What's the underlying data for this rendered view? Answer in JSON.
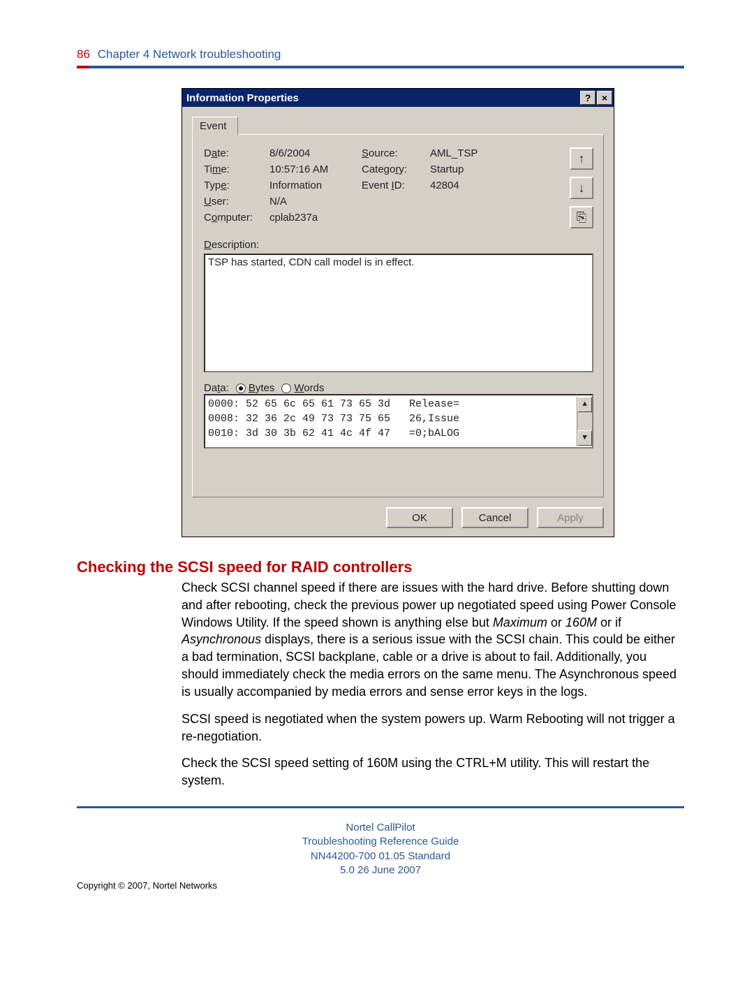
{
  "header": {
    "page_number": "86",
    "chapter": "Chapter 4  Network troubleshooting"
  },
  "dialog": {
    "title": "Information Properties",
    "help_btn": "?",
    "close_btn": "×",
    "tab_label": "Event",
    "fields": {
      "date_label": "Date:",
      "date_value": "8/6/2004",
      "source_label": "Source:",
      "source_value": "AML_TSP",
      "time_label": "Time:",
      "time_value": "10:57:16 AM",
      "category_label": "Category:",
      "category_value": "Startup",
      "type_label": "Type:",
      "type_value": "Information",
      "eventid_label": "Event ID:",
      "eventid_value": "42804",
      "user_label": "User:",
      "user_value": "N/A",
      "computer_label": "Computer:",
      "computer_value": "cplab237a"
    },
    "nav": {
      "up": "↑",
      "down": "↓",
      "copy": "⎘"
    },
    "description_label": "Description:",
    "description_text": "TSP has started, CDN call model is in effect.",
    "data_label": "Data:",
    "bytes_label": "Bytes",
    "words_label": "Words",
    "hex_lines": "0000: 52 65 6c 65 61 73 65 3d   Release=\n0008: 32 36 2c 49 73 73 75 65   26,Issue\n0010: 3d 30 3b 62 41 4c 4f 47   =0;bALOG",
    "scroll_up": "▲",
    "scroll_down": "▼",
    "ok": "OK",
    "cancel": "Cancel",
    "apply": "Apply"
  },
  "section": {
    "heading": "Checking the SCSI speed for RAID controllers",
    "p1a": "Check SCSI channel speed if there are issues with the hard drive. Before shutting down and after rebooting, check the previous power up negotiated speed using Power Console Windows Utility. If the speed shown is anything else but ",
    "p1_em1": "Maximum",
    "p1b": " or ",
    "p1_em2": "160M",
    "p1c": " or if ",
    "p1_em3": "Asynchronous",
    "p1d": " displays, there is a serious issue with the SCSI chain. This could be either a bad termination, SCSI backplane, cable or a drive is about to fail. Additionally, you should immediately check the media errors on the same menu. The Asynchronous speed is usually accompanied by media errors and sense error keys in the logs.",
    "p2": "SCSI speed is negotiated when the system powers up. Warm Rebooting will not trigger a re-negotiation.",
    "p3": "Check the SCSI speed setting of 160M using the CTRL+M utility. This will restart the system."
  },
  "footer": {
    "l1": "Nortel CallPilot",
    "l2": "Troubleshooting Reference Guide",
    "l3": "NN44200-700   01.05   Standard",
    "l4": "5.0   26 June 2007",
    "copyright": "Copyright © 2007, Nortel Networks"
  }
}
